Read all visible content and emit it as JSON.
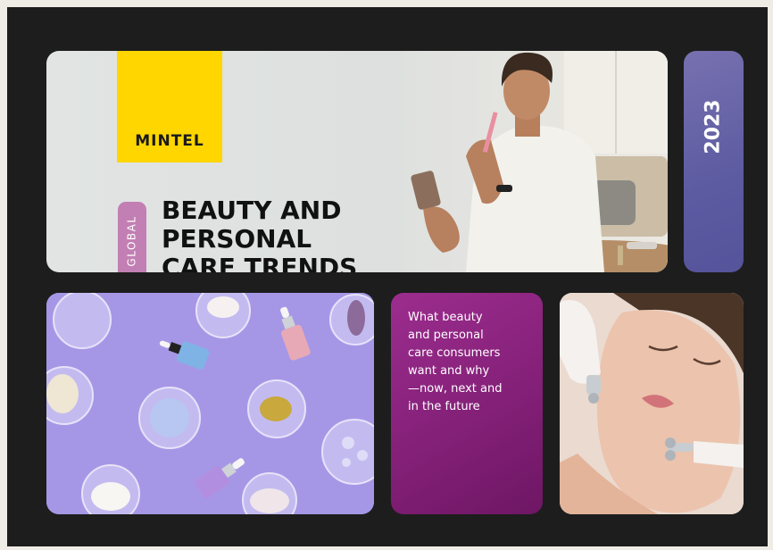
{
  "brand": {
    "logo": "MINTEL"
  },
  "report": {
    "badge": "GLOBAL",
    "title_lines": [
      "BEAUTY AND",
      "PERSONAL",
      "CARE TRENDS"
    ],
    "year": "2023"
  },
  "tagline_lines": [
    "What beauty",
    "and personal",
    "care consumers",
    "want and why",
    "—now, next and",
    "in the future"
  ],
  "colors": {
    "logo_yellow": "#ffd600",
    "badge_pink": "#c27fb3",
    "year_purple": "#5c5aa1",
    "tagline_magenta": "#842078",
    "products_lavender": "#a596e6"
  }
}
